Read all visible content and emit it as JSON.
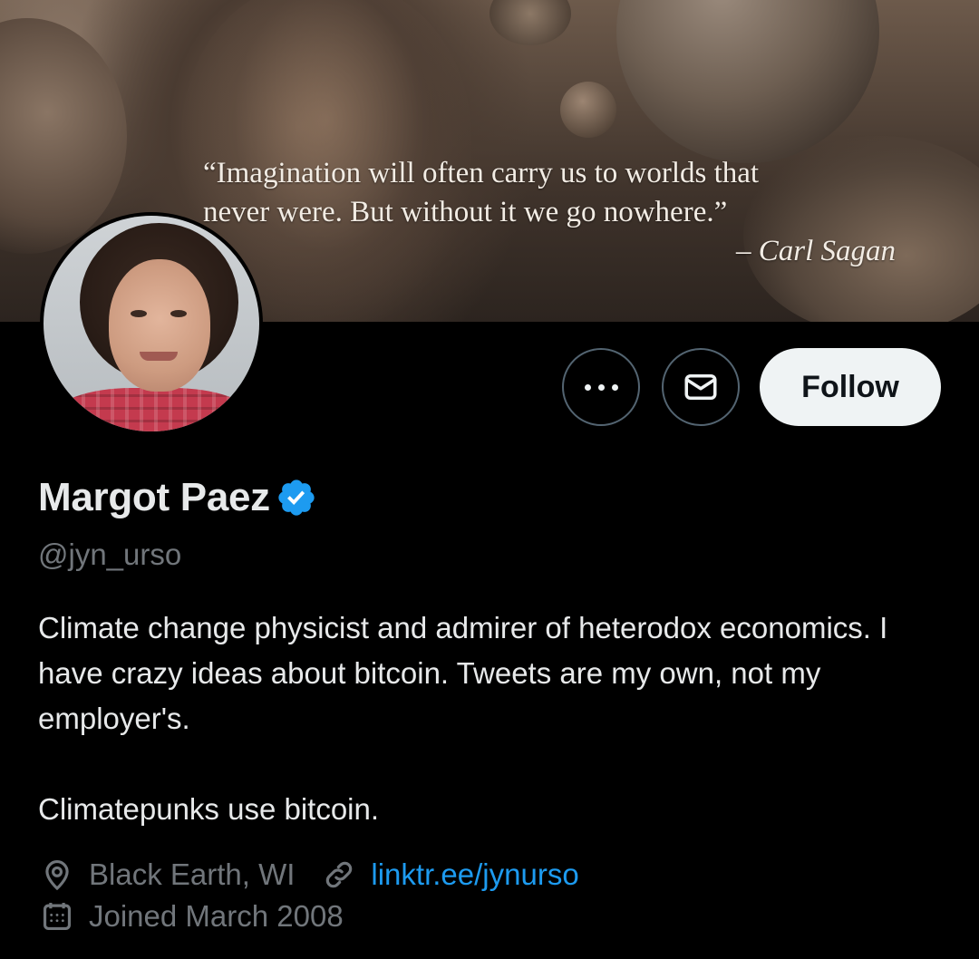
{
  "banner": {
    "quote_line_1": "“Imagination will often carry us to worlds that",
    "quote_line_2": "never were. But without it we go nowhere.”",
    "quote_author": "– Carl Sagan"
  },
  "actions": {
    "more_icon": "more-horizontal-icon",
    "message_icon": "envelope-icon",
    "follow_label": "Follow"
  },
  "profile": {
    "display_name": "Margot Paez",
    "verified_icon": "verified-badge-icon",
    "verified_color": "#1d9bf0",
    "handle": "@jyn_urso",
    "bio_paragraph_1": "Climate change physicist and admirer of heterodox economics. I have crazy ideas about bitcoin. Tweets are my own, not my employer's.",
    "bio_paragraph_2": "Climatepunks use bitcoin.",
    "location_icon": "location-pin-icon",
    "location": "Black Earth, WI",
    "link_icon": "link-icon",
    "website": "linktr.ee/jynurso",
    "link_color": "#1d9bf0",
    "calendar_icon": "calendar-icon",
    "joined": "Joined March 2008"
  }
}
